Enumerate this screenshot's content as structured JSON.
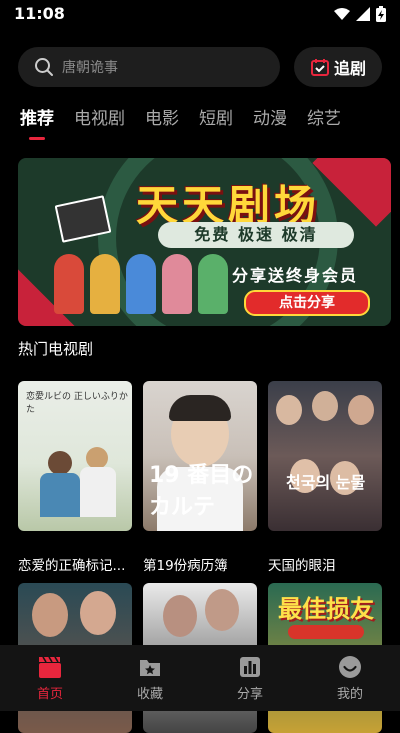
{
  "status_bar": {
    "time": "11:08"
  },
  "search": {
    "placeholder": "唐朝诡事"
  },
  "follow_button": {
    "label": "追剧"
  },
  "tabs": [
    {
      "label": "推荐",
      "active": true
    },
    {
      "label": "电视剧",
      "active": false
    },
    {
      "label": "电影",
      "active": false
    },
    {
      "label": "短剧",
      "active": false
    },
    {
      "label": "动漫",
      "active": false
    },
    {
      "label": "综艺",
      "active": false
    }
  ],
  "banner": {
    "title": "天天剧场",
    "tagline": "免费 极速 极清",
    "promo": "分享送终身会员",
    "button": "点击分享"
  },
  "section": {
    "title": "热门电视剧"
  },
  "shows": [
    {
      "title": "恋爱的正确标记...",
      "poster_text": "恋愛ルビの 正しいふりかた"
    },
    {
      "title": "第19份病历簿",
      "poster_text": "19 番目のカルテ"
    },
    {
      "title": "天国的眼泪",
      "poster_text": "천국의 눈물"
    },
    {
      "title": "",
      "poster_text": ""
    },
    {
      "title": "",
      "poster_text": ""
    },
    {
      "title": "",
      "poster_text": "最佳损友"
    }
  ],
  "bottom_nav": [
    {
      "label": "首页",
      "icon": "clapper-icon",
      "active": true
    },
    {
      "label": "收藏",
      "icon": "star-folder-icon",
      "active": false
    },
    {
      "label": "分享",
      "icon": "bar-chart-icon",
      "active": false
    },
    {
      "label": "我的",
      "icon": "smiley-icon",
      "active": false
    }
  ],
  "colors": {
    "accent": "#e8263d",
    "background": "#000000"
  }
}
